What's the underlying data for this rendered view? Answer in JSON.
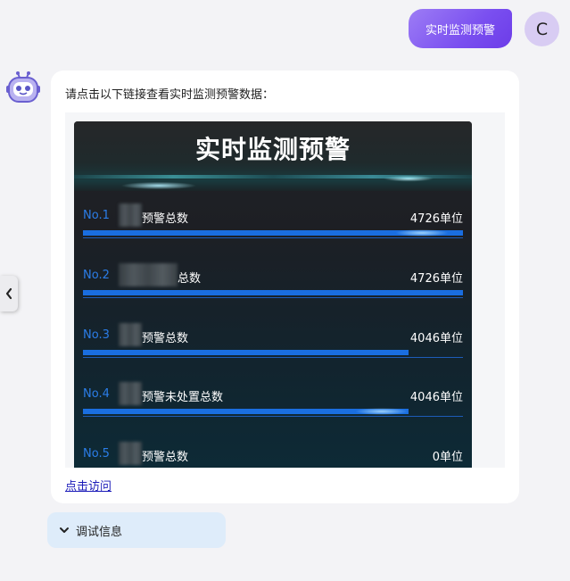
{
  "user_message": {
    "text": "实时监测预警",
    "avatar_letter": "C"
  },
  "bot_message": {
    "intro": "请点击以下链接查看实时监测预警数据：",
    "link_label": "点击访问"
  },
  "dashboard": {
    "title": "实时监测预警",
    "rows": [
      {
        "rank": "No.1",
        "name": "预警总数",
        "value": "4726单位",
        "fill": 1.0
      },
      {
        "rank": "No.2",
        "name": "总数",
        "value": "4726单位",
        "fill": 1.0
      },
      {
        "rank": "No.3",
        "name": "预警总数",
        "value": "4046单位",
        "fill": 0.856
      },
      {
        "rank": "No.4",
        "name": "预警未处置总数",
        "value": "4046单位",
        "fill": 0.856
      },
      {
        "rank": "No.5",
        "name": "预警总数",
        "value": "0单位",
        "fill": 0.0
      }
    ]
  },
  "debug": {
    "label": "调试信息"
  },
  "icons": {
    "bot": "robot-icon",
    "side_tab": "chevron-left-icon",
    "debug": "chevron-down-icon"
  },
  "colors": {
    "accent_purple": "#7a4ff0",
    "bar_blue": "#1a6ee0",
    "rank_blue": "#2b7de8"
  }
}
